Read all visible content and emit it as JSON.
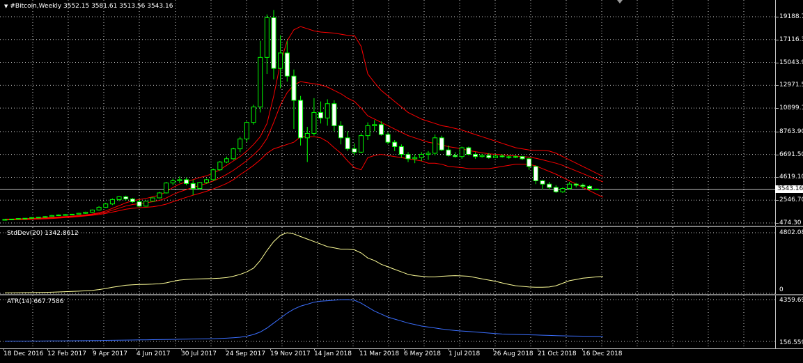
{
  "main": {
    "title_arrow": "▼",
    "title": "#Bitcoin,Weekly  3552.15 3581.61 3513.56 3543.16",
    "price_ticks": [
      "19188.70",
      "17116.30",
      "15043.90",
      "12971.50",
      "10899.10",
      "8763.90",
      "6691.50",
      "4619.10",
      "2546.70",
      "474.30"
    ],
    "current_price": "3543.16"
  },
  "stddev": {
    "label": "StdDev(20) 1342.8612",
    "ticks": [
      "4802.084",
      "0"
    ]
  },
  "atr": {
    "label": "ATR(14) 667.7586",
    "ticks": [
      "4359.698",
      "156.559"
    ]
  },
  "time_labels": [
    "18 Dec 2016",
    "12 Feb 2017",
    "9 Apr 2017",
    "4 Jun 2017",
    "30 Jul 2017",
    "24 Sep 2017",
    "19 Nov 2017",
    "14 Jan 2018",
    "11 Mar 2018",
    "6 May 2018",
    "1 Jul 2018",
    "26 Aug 2018",
    "21 Oct 2018",
    "16 Dec 2018"
  ],
  "colors": {
    "bull": "#00ff00",
    "bull_fill": "#000000",
    "bear_fill": "#ffffff",
    "bands": "#ff0000",
    "stddev_line": "#ffff99",
    "atr_line": "#3b6fff",
    "grid": "#d0d0d0"
  },
  "chart_data": [
    {
      "type": "candlestick",
      "title": "#Bitcoin,Weekly",
      "ylim": [
        474.3,
        19600
      ],
      "candles_ohlc": [
        [
          790,
          800,
          760,
          780
        ],
        [
          780,
          850,
          770,
          820
        ],
        [
          820,
          900,
          800,
          880
        ],
        [
          880,
          920,
          860,
          900
        ],
        [
          900,
          980,
          880,
          960
        ],
        [
          960,
          1000,
          940,
          990
        ],
        [
          990,
          1100,
          970,
          1050
        ],
        [
          1050,
          1200,
          1020,
          1150
        ],
        [
          1150,
          1250,
          1100,
          1200
        ],
        [
          1200,
          1280,
          1150,
          1230
        ],
        [
          1230,
          1300,
          1200,
          1270
        ],
        [
          1270,
          1400,
          1250,
          1350
        ],
        [
          1350,
          1500,
          1300,
          1450
        ],
        [
          1450,
          1700,
          1400,
          1650
        ],
        [
          1650,
          2000,
          1600,
          1900
        ],
        [
          1900,
          2300,
          1850,
          2200
        ],
        [
          2200,
          2700,
          2100,
          2600
        ],
        [
          2600,
          2900,
          2450,
          2850
        ],
        [
          2850,
          2950,
          2500,
          2650
        ],
        [
          2650,
          2750,
          2300,
          2400
        ],
        [
          2400,
          2600,
          1900,
          2000
        ],
        [
          2000,
          2500,
          1950,
          2450
        ],
        [
          2450,
          2800,
          2400,
          2750
        ],
        [
          2750,
          3300,
          2700,
          3200
        ],
        [
          3200,
          4200,
          3150,
          4100
        ],
        [
          4100,
          4500,
          3900,
          4300
        ],
        [
          4300,
          4700,
          4100,
          4400
        ],
        [
          4400,
          4600,
          3900,
          4050
        ],
        [
          4050,
          4400,
          3000,
          3600
        ],
        [
          3600,
          4200,
          3500,
          4150
        ],
        [
          4150,
          4500,
          4050,
          4400
        ],
        [
          4400,
          5400,
          4300,
          5300
        ],
        [
          5300,
          6100,
          5200,
          6000
        ],
        [
          6000,
          6500,
          5900,
          6300
        ],
        [
          6300,
          7300,
          6200,
          7200
        ],
        [
          7200,
          8300,
          6900,
          8100
        ],
        [
          8100,
          9700,
          7800,
          9600
        ],
        [
          9600,
          11200,
          9400,
          11000
        ],
        [
          11000,
          17000,
          10500,
          15500
        ],
        [
          15500,
          19400,
          14000,
          19100
        ],
        [
          19100,
          19800,
          13500,
          14500
        ],
        [
          14500,
          17500,
          12700,
          15900
        ],
        [
          15900,
          17000,
          13300,
          13800
        ],
        [
          13800,
          14400,
          9000,
          11600
        ],
        [
          11600,
          12000,
          7500,
          8200
        ],
        [
          8200,
          9200,
          6000,
          8600
        ],
        [
          8600,
          11800,
          8400,
          10500
        ],
        [
          10500,
          11500,
          9500,
          10000
        ],
        [
          10000,
          11700,
          9300,
          11300
        ],
        [
          11300,
          11600,
          8800,
          9300
        ],
        [
          9300,
          9700,
          7600,
          8200
        ],
        [
          8200,
          8800,
          7000,
          7200
        ],
        [
          7200,
          7700,
          6600,
          6900
        ],
        [
          6900,
          8600,
          6800,
          8400
        ],
        [
          8400,
          9600,
          8000,
          9300
        ],
        [
          9300,
          9800,
          8800,
          9400
        ],
        [
          9400,
          9700,
          8400,
          8500
        ],
        [
          8500,
          8700,
          7600,
          7800
        ],
        [
          7800,
          8000,
          7000,
          7400
        ],
        [
          7400,
          7600,
          6400,
          6700
        ],
        [
          6700,
          6900,
          6000,
          6300
        ],
        [
          6300,
          6700,
          5900,
          6400
        ],
        [
          6400,
          6900,
          6100,
          6700
        ],
        [
          6700,
          7000,
          6200,
          6800
        ],
        [
          6800,
          8500,
          6600,
          8200
        ],
        [
          8200,
          8400,
          7000,
          7100
        ],
        [
          7100,
          7500,
          6500,
          6600
        ],
        [
          6600,
          6900,
          6400,
          6500
        ],
        [
          6500,
          7400,
          6300,
          7300
        ],
        [
          7300,
          7400,
          6600,
          6700
        ],
        [
          6700,
          6900,
          6300,
          6500
        ],
        [
          6500,
          6750,
          6400,
          6600
        ],
        [
          6600,
          6800,
          6300,
          6400
        ],
        [
          6400,
          6700,
          6350,
          6550
        ],
        [
          6550,
          6700,
          6400,
          6480
        ],
        [
          6480,
          6600,
          6300,
          6450
        ],
        [
          6450,
          6600,
          6350,
          6500
        ],
        [
          6500,
          6550,
          6200,
          6300
        ],
        [
          6300,
          6400,
          5300,
          5600
        ],
        [
          5600,
          5700,
          4000,
          4300
        ],
        [
          4300,
          4400,
          3500,
          4000
        ],
        [
          4000,
          4200,
          3500,
          3700
        ],
        [
          3700,
          3900,
          3200,
          3300
        ],
        [
          3300,
          3700,
          3200,
          3600
        ],
        [
          3600,
          4200,
          3500,
          4000
        ],
        [
          4000,
          4100,
          3700,
          3900
        ],
        [
          3900,
          4050,
          3600,
          3800
        ],
        [
          3800,
          3900,
          3450,
          3600
        ],
        [
          3552.15,
          3581.61,
          3513.56,
          3543.16
        ]
      ],
      "upper_band": [
        820,
        830,
        850,
        870,
        890,
        920,
        950,
        980,
        1020,
        1060,
        1100,
        1150,
        1210,
        1290,
        1400,
        1560,
        1800,
        2050,
        2300,
        2500,
        2600,
        2700,
        2850,
        3000,
        3300,
        3700,
        4000,
        4200,
        4400,
        4600,
        4750,
        5000,
        5300,
        5700,
        6100,
        6500,
        7000,
        7600,
        8300,
        9500,
        12000,
        15000,
        17000,
        18000,
        18300,
        18100,
        17900,
        17800,
        17750,
        17700,
        17600,
        17500,
        17500,
        16500,
        14000,
        13200,
        12500,
        12000,
        11500,
        11000,
        10500,
        10200,
        9900,
        9700,
        9500,
        9300,
        9200,
        9050,
        8900,
        8700,
        8500,
        8300,
        8100,
        7900,
        7700,
        7500,
        7300,
        7200,
        7100,
        7050,
        7050,
        7000,
        6800,
        6500,
        6200,
        5900,
        5600,
        5300,
        5000,
        4700
      ],
      "middle_band": [
        790,
        795,
        810,
        825,
        845,
        870,
        900,
        930,
        970,
        1010,
        1050,
        1100,
        1160,
        1230,
        1320,
        1450,
        1630,
        1820,
        2010,
        2150,
        2230,
        2300,
        2400,
        2520,
        2740,
        3050,
        3300,
        3500,
        3700,
        3880,
        4050,
        4280,
        4550,
        4880,
        5250,
        5680,
        6130,
        6650,
        7250,
        8150,
        9600,
        11200,
        12300,
        13000,
        13300,
        13200,
        13100,
        13000,
        12800,
        12500,
        12200,
        11800,
        11500,
        10900,
        10200,
        9900,
        9600,
        9300,
        9000,
        8700,
        8400,
        8200,
        8000,
        7800,
        7700,
        7550,
        7400,
        7300,
        7200,
        7050,
        6950,
        6850,
        6750,
        6700,
        6650,
        6600,
        6550,
        6500,
        6450,
        6350,
        6200,
        6050,
        5900,
        5700,
        5450,
        5200,
        4950,
        4700,
        4450,
        4200
      ],
      "lower_band": [
        760,
        760,
        770,
        780,
        800,
        820,
        850,
        880,
        920,
        960,
        1000,
        1050,
        1110,
        1170,
        1240,
        1340,
        1460,
        1590,
        1720,
        1800,
        1860,
        1900,
        1950,
        2040,
        2180,
        2400,
        2600,
        2800,
        3000,
        3160,
        3350,
        3560,
        3800,
        4060,
        4400,
        4860,
        5260,
        5700,
        6200,
        6800,
        7200,
        7400,
        7600,
        7800,
        8300,
        8300,
        8300,
        8200,
        7850,
        7300,
        6800,
        6100,
        5500,
        5300,
        6400,
        6600,
        6700,
        6600,
        6500,
        6400,
        6300,
        6200,
        6100,
        5900,
        5900,
        5800,
        5600,
        5550,
        5500,
        5400,
        5400,
        5400,
        5400,
        5500,
        5600,
        5700,
        5800,
        5800,
        5800,
        5650,
        5400,
        5150,
        4900,
        4600,
        4300,
        4000,
        3700,
        3400,
        3100,
        2800
      ],
      "current_price": 3543.16
    },
    {
      "type": "line",
      "title": "StdDev(20)",
      "ylim": [
        0,
        4802.084
      ],
      "values": [
        40,
        45,
        50,
        55,
        60,
        70,
        80,
        90,
        110,
        130,
        150,
        170,
        200,
        240,
        300,
        380,
        480,
        560,
        640,
        680,
        700,
        710,
        730,
        760,
        830,
        950,
        1050,
        1100,
        1130,
        1150,
        1160,
        1170,
        1200,
        1250,
        1350,
        1500,
        1700,
        2000,
        2600,
        3400,
        4100,
        4600,
        4800,
        4700,
        4500,
        4300,
        4100,
        3900,
        3700,
        3600,
        3500,
        3500,
        3450,
        3200,
        2800,
        2600,
        2300,
        2100,
        1900,
        1700,
        1500,
        1400,
        1350,
        1300,
        1300,
        1350,
        1380,
        1400,
        1380,
        1350,
        1250,
        1150,
        1050,
        950,
        820,
        700,
        600,
        550,
        500,
        480,
        480,
        500,
        600,
        800,
        1000,
        1100,
        1200,
        1250,
        1300,
        1342.86
      ]
    },
    {
      "type": "line",
      "title": "ATR(14)",
      "ylim": [
        156.559,
        4359.698
      ],
      "values": [
        180,
        182,
        185,
        188,
        190,
        195,
        200,
        205,
        210,
        215,
        220,
        225,
        232,
        240,
        250,
        260,
        270,
        280,
        290,
        300,
        310,
        320,
        330,
        340,
        350,
        360,
        375,
        390,
        400,
        410,
        420,
        430,
        450,
        480,
        520,
        580,
        680,
        850,
        1100,
        1500,
        2000,
        2500,
        3000,
        3400,
        3700,
        3900,
        4100,
        4200,
        4250,
        4300,
        4350,
        4359,
        4300,
        4000,
        3600,
        3200,
        2900,
        2600,
        2400,
        2200,
        2000,
        1850,
        1700,
        1600,
        1500,
        1400,
        1320,
        1250,
        1200,
        1150,
        1100,
        1050,
        1000,
        950,
        900,
        880,
        860,
        840,
        820,
        800,
        780,
        760,
        740,
        720,
        700,
        690,
        680,
        675,
        670,
        667.76
      ]
    }
  ]
}
